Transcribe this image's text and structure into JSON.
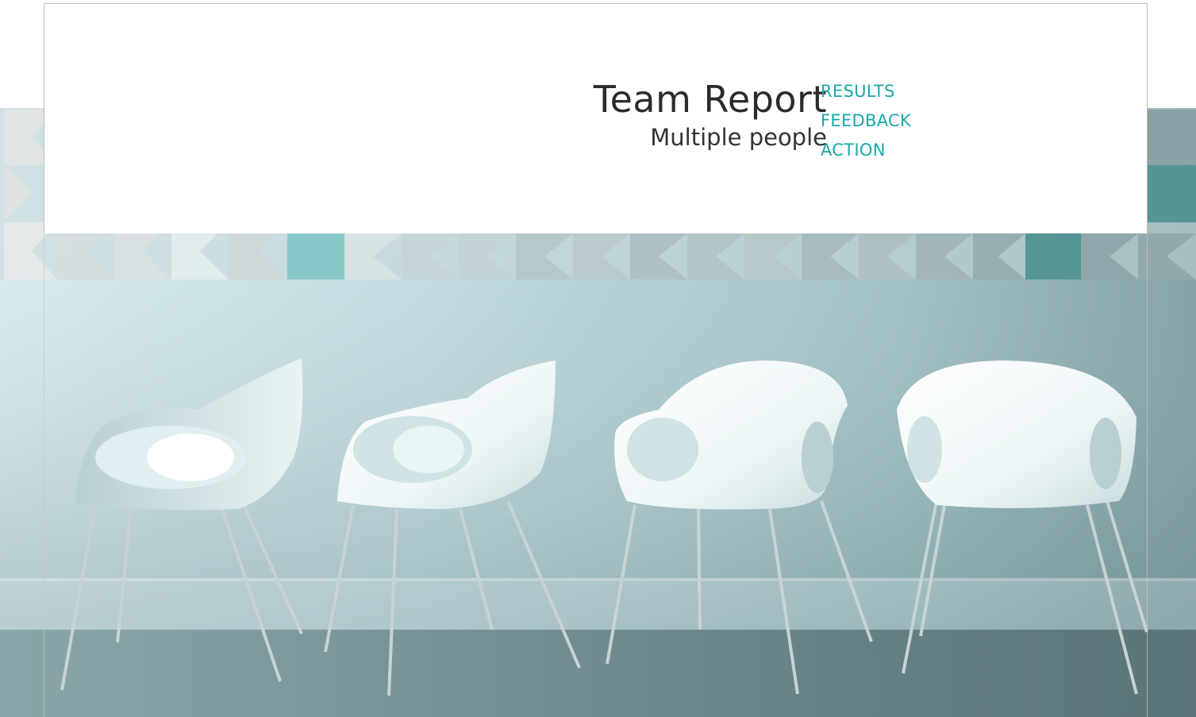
{
  "header": {
    "title": "Team Report",
    "subtitle": "Multiple people"
  },
  "nav": {
    "items": [
      {
        "label": "RESULTS"
      },
      {
        "label": "FEEDBACK"
      },
      {
        "label": "ACTION"
      }
    ]
  },
  "colors": {
    "accent": "#1aa7aa",
    "title": "#2b2b2b",
    "teal_tile": "#7fc6c4",
    "dark_teal_tile": "#4f9391"
  }
}
